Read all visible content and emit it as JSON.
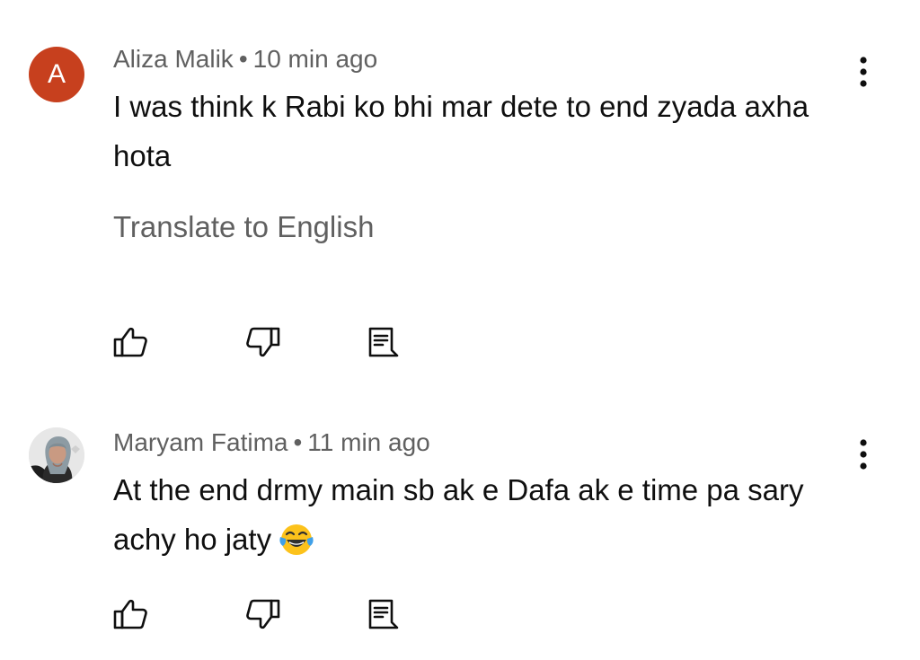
{
  "comments": [
    {
      "avatar_letter": "A",
      "author": "Aliza Malik",
      "separator": "•",
      "time": "10 min ago",
      "text": "I was think k Rabi ko bhi mar dete to end zyada axha hota",
      "translate_label": "Translate to English",
      "avatar_color": "#c7401e"
    },
    {
      "author": "Maryam Fatima",
      "separator": "•",
      "time": "11 min ago",
      "text": "At the end drmy main sb ak e Dafa ak e time pa sary achy ho jaty",
      "emoji": "face-with-tears-of-joy"
    }
  ],
  "icons": {
    "like": "thumb-up-icon",
    "dislike": "thumb-down-icon",
    "reply": "reply-comment-icon",
    "more": "more-vert-icon"
  },
  "colors": {
    "meta_text": "#606060",
    "body_text": "#0f0f0f",
    "background": "#ffffff"
  }
}
